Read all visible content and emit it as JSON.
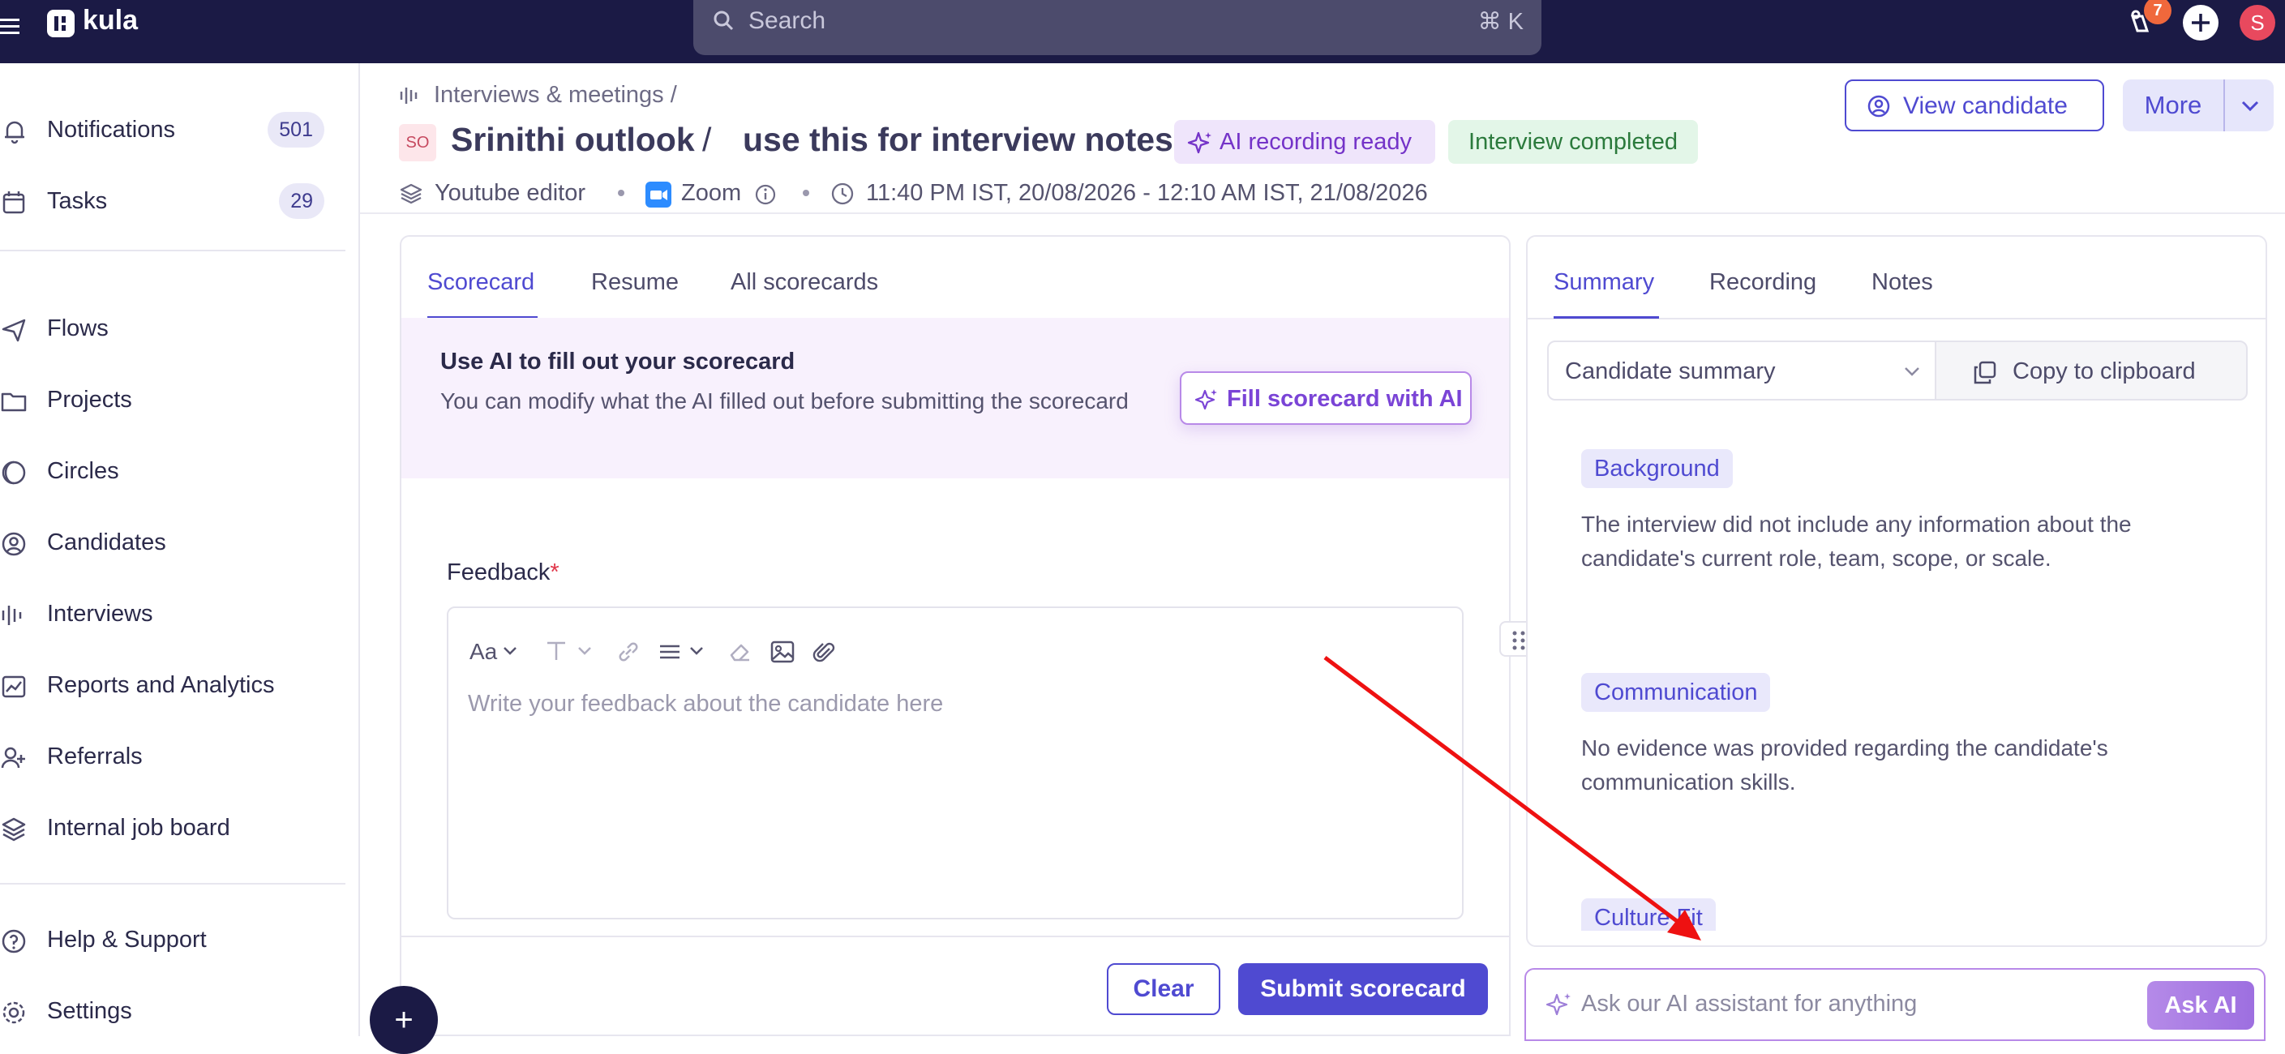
{
  "topbar": {
    "logo": "kula",
    "search_placeholder": "Search",
    "search_shortcut": "⌘ K",
    "notification_count": "7",
    "avatar_initial": "S"
  },
  "sidebar": {
    "items": [
      {
        "label": "Notifications",
        "count": "501",
        "icon": "bell-icon"
      },
      {
        "label": "Tasks",
        "count": "29",
        "icon": "calendar-icon"
      },
      {
        "label": "Flows",
        "icon": "send-icon"
      },
      {
        "label": "Projects",
        "icon": "folder-icon"
      },
      {
        "label": "Circles",
        "icon": "circles-icon"
      },
      {
        "label": "Candidates",
        "icon": "user-circle-icon"
      },
      {
        "label": "Interviews",
        "icon": "waveform-icon"
      },
      {
        "label": "Reports and Analytics",
        "icon": "chart-icon"
      },
      {
        "label": "Referrals",
        "icon": "referral-icon"
      },
      {
        "label": "Internal job board",
        "icon": "layers-icon"
      }
    ],
    "bottom": [
      {
        "label": "Help & Support",
        "icon": "help-icon"
      },
      {
        "label": "Settings",
        "icon": "gear-icon"
      }
    ]
  },
  "header": {
    "breadcrumb": "Interviews & meetings /",
    "initials": "SO",
    "candidate_name": "Srinithi outlook",
    "separator": "/",
    "meeting_title": "use this for interview notes",
    "ai_badge": "AI recording ready",
    "status_badge": "Interview completed",
    "view_candidate": "View candidate",
    "more": "More",
    "meta": {
      "workspace": "Youtube editor",
      "platform": "Zoom",
      "time": "11:40 PM IST, 20/08/2026 - 12:10 AM IST, 21/08/2026"
    }
  },
  "left_panel": {
    "tabs": [
      "Scorecard",
      "Resume",
      "All scorecards"
    ],
    "active_tab": "Scorecard",
    "ai_banner": {
      "title": "Use AI to fill out your scorecard",
      "description": "You can modify what the AI filled out before submitting the scorecard",
      "button": "Fill scorecard with AI"
    },
    "feedback": {
      "label": "Feedback",
      "required_mark": "*",
      "font_tool": "Aa",
      "placeholder": "Write your feedback about the candidate here"
    },
    "clear": "Clear",
    "submit": "Submit scorecard"
  },
  "right_panel": {
    "tabs": [
      "Summary",
      "Recording",
      "Notes"
    ],
    "active_tab": "Summary",
    "summary_type": "Candidate summary",
    "copy": "Copy to clipboard",
    "sections": [
      {
        "title": "Background",
        "text": "The interview did not include any information about the candidate's current role, team, scope, or scale."
      },
      {
        "title": "Communication",
        "text": "No evidence was provided regarding the candidate's communication skills."
      },
      {
        "title": "Culture Fit",
        "text": ""
      }
    ]
  },
  "ask_ai": {
    "placeholder": "Ask our AI assistant for anything",
    "button": "Ask AI"
  },
  "fab_label": "+",
  "colors": {
    "topbar": "#1b1a45",
    "accent": "#4f4ad1",
    "ai_purple": "#7433c8",
    "success": "#2b7a3c",
    "annotation": "#ee1111"
  }
}
